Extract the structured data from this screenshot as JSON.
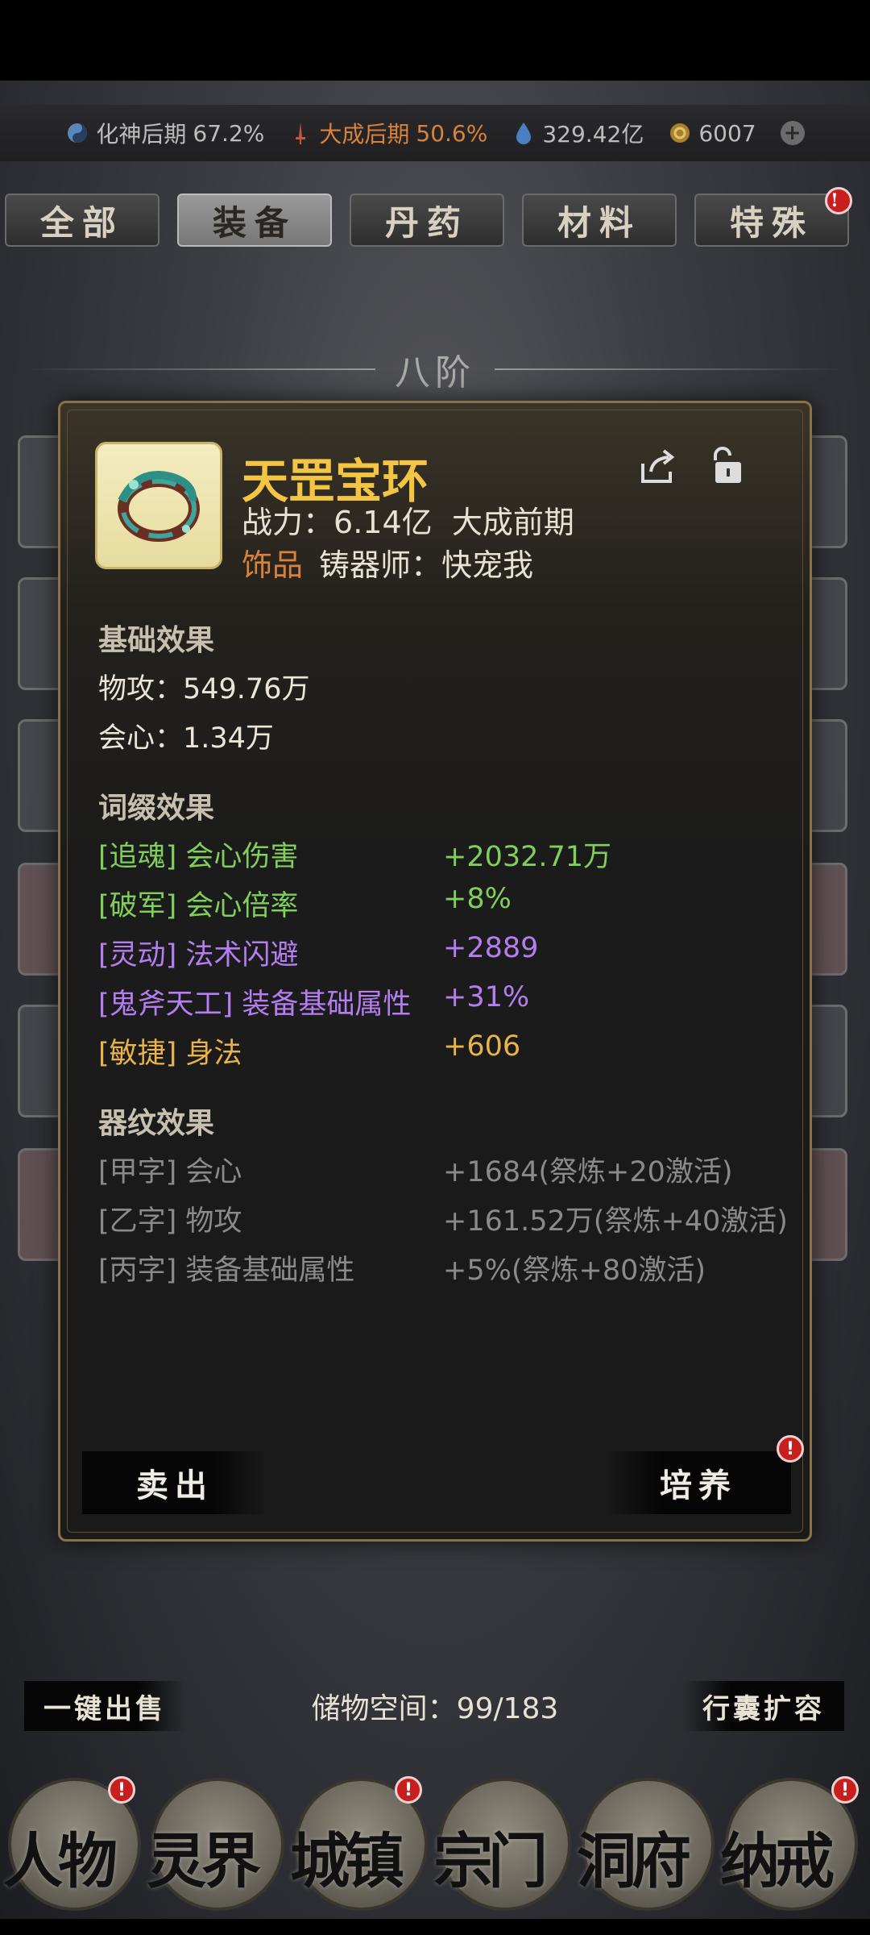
{
  "status": {
    "realm_label": "化神后期",
    "realm_pct": "67.2%",
    "realm2_label": "大成后期",
    "realm2_pct": "50.6%",
    "spirit_stones": "329.42亿",
    "currency": "6007"
  },
  "tabs": [
    {
      "label": "全部",
      "active": false
    },
    {
      "label": "装备",
      "active": true
    },
    {
      "label": "丹药",
      "active": false
    },
    {
      "label": "材料",
      "active": false
    },
    {
      "label": "特殊",
      "active": false,
      "badge": "!"
    }
  ],
  "tier_title": "八阶",
  "item": {
    "name": "天罡宝环",
    "power_label": "战力：",
    "power_value": "6.14亿",
    "power_stage": "大成前期",
    "category": "饰品",
    "smith_label": "铸器师：",
    "smith_name": "快宠我"
  },
  "base_effects": {
    "title": "基础效果",
    "lines": [
      {
        "text": "物攻：549.76万"
      },
      {
        "text": "会心：1.34万"
      }
    ]
  },
  "affix_effects": {
    "title": "词缀效果",
    "lines": [
      {
        "name": "[追魂] 会心伤害",
        "value": "+2032.71万",
        "color": "#7fcf5a"
      },
      {
        "name": "[破军] 会心倍率",
        "value": "+8%",
        "color": "#7fcf5a"
      },
      {
        "name": "[灵动] 法术闪避",
        "value": "+2889",
        "color": "#b57ef0"
      },
      {
        "name": "[鬼斧天工] 装备基础属性",
        "value": "+31%",
        "color": "#b57ef0"
      },
      {
        "name": "[敏捷] 身法",
        "value": "+606",
        "color": "#e8b44a"
      }
    ]
  },
  "pattern_effects": {
    "title": "器纹效果",
    "lines": [
      {
        "name": "[甲字] 会心",
        "value": "+1684(祭炼+20激活)"
      },
      {
        "name": "[乙字] 物攻",
        "value": "+161.52万(祭炼+40激活)"
      },
      {
        "name": "[丙字] 装备基础属性",
        "value": "+5%(祭炼+80激活)"
      }
    ]
  },
  "buttons": {
    "sell": "卖出",
    "cultivate": "培养",
    "cultivate_badge": "!"
  },
  "bottom": {
    "quick_sell": "一键出售",
    "storage_label": "储物空间：",
    "storage_value": "99/183",
    "expand": "行囊扩容"
  },
  "nav": [
    {
      "label": "人物",
      "badge": "!"
    },
    {
      "label": "灵界"
    },
    {
      "label": "城镇",
      "badge": "!"
    },
    {
      "label": "宗门"
    },
    {
      "label": "洞府"
    },
    {
      "label": "纳戒",
      "badge": "!"
    }
  ],
  "colors": {
    "gold_title": "#f3c542",
    "orange": "#d9823d",
    "green": "#7fcf5a",
    "purple": "#b57ef0",
    "gray": "#8a8a8a"
  }
}
